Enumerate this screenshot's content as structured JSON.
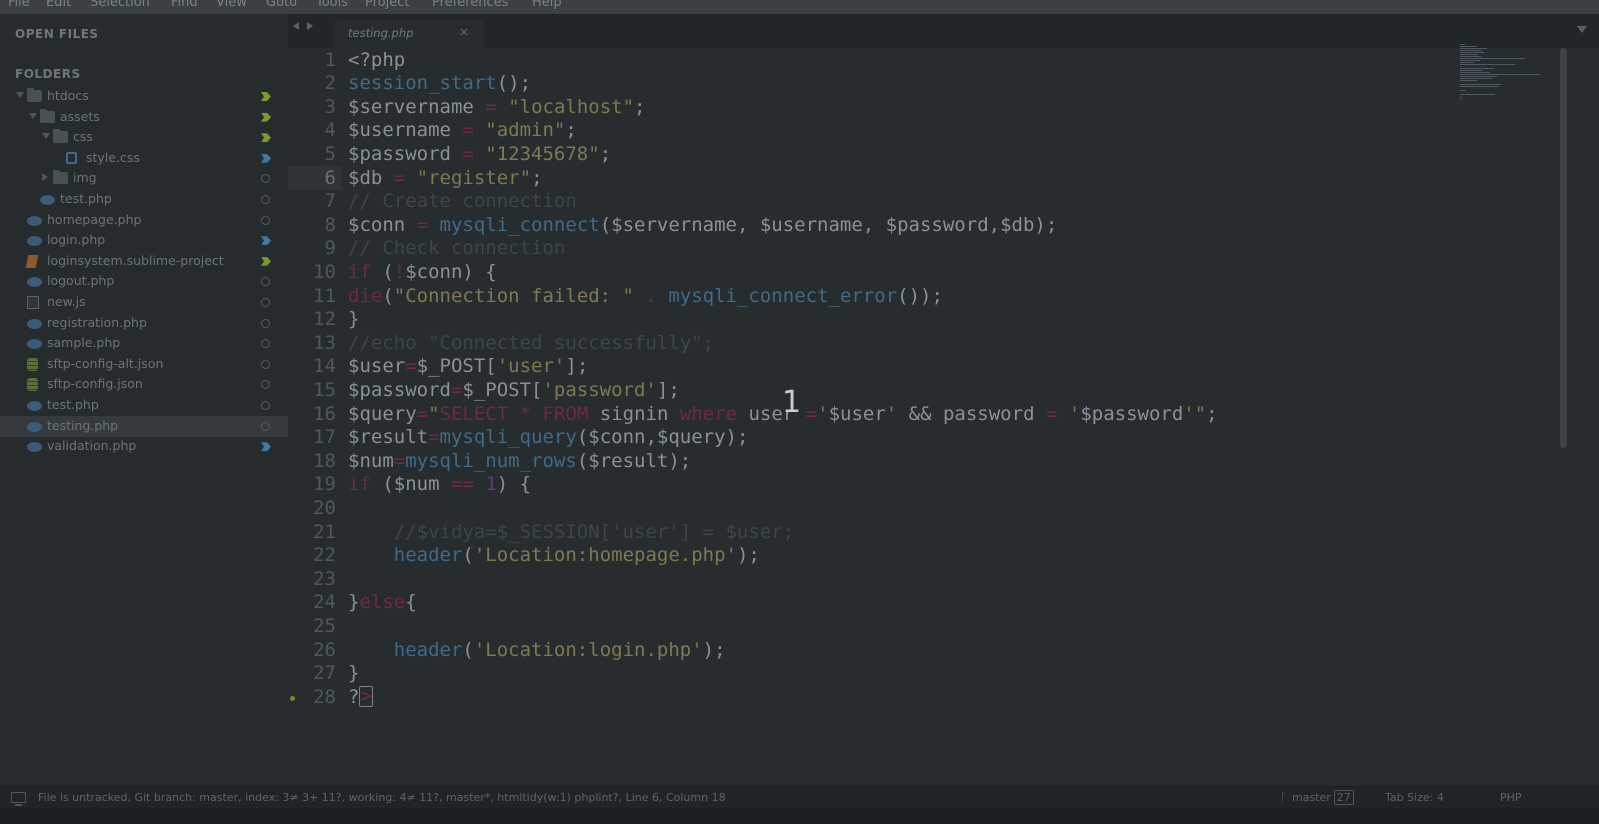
{
  "menu": [
    "File",
    "Edit",
    "Selection",
    "Find",
    "View",
    "Goto",
    "Tools",
    "Project",
    "Preferences",
    "Help"
  ],
  "sidebar": {
    "open_files_title": "OPEN FILES",
    "folders_title": "FOLDERS",
    "items": [
      {
        "label": "htdocs",
        "type": "folder",
        "expanded": true,
        "status": "modified"
      },
      {
        "label": "assets",
        "type": "folder",
        "expanded": true,
        "status": "modified"
      },
      {
        "label": "css",
        "type": "folder",
        "expanded": true,
        "status": "modified"
      },
      {
        "label": "style.css",
        "type": "css",
        "status": "modified-blue"
      },
      {
        "label": "img",
        "type": "folder",
        "expanded": false,
        "status": "untracked"
      },
      {
        "label": "test.php",
        "type": "php",
        "status": "untracked"
      },
      {
        "label": "homepage.php",
        "type": "php",
        "status": "untracked"
      },
      {
        "label": "login.php",
        "type": "php",
        "status": "modified-blue"
      },
      {
        "label": "loginsystem.sublime-project",
        "type": "sublime",
        "status": "modified"
      },
      {
        "label": "logout.php",
        "type": "php",
        "status": "untracked"
      },
      {
        "label": "new.js",
        "type": "js",
        "status": "untracked"
      },
      {
        "label": "registration.php",
        "type": "php",
        "status": "untracked"
      },
      {
        "label": "sample.php",
        "type": "php",
        "status": "untracked"
      },
      {
        "label": "sftp-config-alt.json",
        "type": "json",
        "status": "untracked"
      },
      {
        "label": "sftp-config.json",
        "type": "json",
        "status": "untracked"
      },
      {
        "label": "test.php",
        "type": "php",
        "status": "untracked"
      },
      {
        "label": "testing.php",
        "type": "php",
        "status": "untracked",
        "active": true
      },
      {
        "label": "validation.php",
        "type": "php",
        "status": "modified-blue"
      }
    ]
  },
  "tabs": {
    "active_label": "testing.php",
    "close_glyph": "×"
  },
  "editor": {
    "current_line": 6,
    "lines": [
      [
        [
          "t-pl",
          "<?php"
        ]
      ],
      [
        [
          "t-fn",
          "session_start"
        ],
        [
          "t-pl",
          "();"
        ]
      ],
      [
        [
          "t-pl",
          "$servername "
        ],
        [
          "t-op",
          "="
        ],
        [
          "t-pl",
          " "
        ],
        [
          "t-str",
          "\"localhost\""
        ],
        [
          "t-pl",
          ";"
        ]
      ],
      [
        [
          "t-pl",
          "$username "
        ],
        [
          "t-op",
          "="
        ],
        [
          "t-pl",
          " "
        ],
        [
          "t-str",
          "\"admin\""
        ],
        [
          "t-pl",
          ";"
        ]
      ],
      [
        [
          "t-pl",
          "$password "
        ],
        [
          "t-op",
          "="
        ],
        [
          "t-pl",
          " "
        ],
        [
          "t-str",
          "\"12345678\""
        ],
        [
          "t-pl",
          ";"
        ]
      ],
      [
        [
          "t-pl",
          "$db "
        ],
        [
          "t-op",
          "="
        ],
        [
          "t-pl",
          " "
        ],
        [
          "t-str",
          "\"register\""
        ],
        [
          "t-pl",
          ";"
        ]
      ],
      [
        [
          "t-cm",
          "// Create connection"
        ]
      ],
      [
        [
          "t-pl",
          "$conn "
        ],
        [
          "t-op",
          "="
        ],
        [
          "t-pl",
          " "
        ],
        [
          "t-fn",
          "mysqli_connect"
        ],
        [
          "t-pl",
          "($servername, $username, $password,$db);"
        ]
      ],
      [
        [
          "t-cm",
          "// Check connection"
        ]
      ],
      [
        [
          "t-kw",
          "if"
        ],
        [
          "t-pl",
          " ("
        ],
        [
          "t-op",
          "!"
        ],
        [
          "t-pl",
          "$conn) {"
        ]
      ],
      [
        [
          "t-kw",
          "die"
        ],
        [
          "t-pl",
          "("
        ],
        [
          "t-str",
          "\"Connection failed: \""
        ],
        [
          "t-pl",
          " "
        ],
        [
          "t-op",
          "."
        ],
        [
          "t-pl",
          " "
        ],
        [
          "t-fn",
          "mysqli_connect_error"
        ],
        [
          "t-pl",
          "());"
        ]
      ],
      [
        [
          "t-pl",
          "}"
        ]
      ],
      [
        [
          "t-cm",
          "//echo \"Connected successfully\";"
        ]
      ],
      [
        [
          "t-pl",
          "$user"
        ],
        [
          "t-op",
          "="
        ],
        [
          "t-pl",
          "$_POST["
        ],
        [
          "t-str",
          "'user'"
        ],
        [
          "t-pl",
          "];"
        ]
      ],
      [
        [
          "t-pl",
          "$password"
        ],
        [
          "t-op",
          "="
        ],
        [
          "t-pl",
          "$_POST["
        ],
        [
          "t-str",
          "'password'"
        ],
        [
          "t-pl",
          "];"
        ]
      ],
      [
        [
          "t-pl",
          "$query"
        ],
        [
          "t-op",
          "="
        ],
        [
          "t-str",
          "\""
        ],
        [
          "t-kw",
          "SELECT"
        ],
        [
          "t-pl",
          " "
        ],
        [
          "t-op",
          "*"
        ],
        [
          "t-pl",
          " "
        ],
        [
          "t-kw",
          "FROM"
        ],
        [
          "t-pl",
          " signin "
        ],
        [
          "t-kw",
          "where"
        ],
        [
          "t-pl",
          " user "
        ],
        [
          "t-op",
          "="
        ],
        [
          "t-str",
          "'"
        ],
        [
          "t-pl",
          "$user"
        ],
        [
          "t-str",
          "'"
        ],
        [
          "t-pl",
          " && password "
        ],
        [
          "t-op",
          "="
        ],
        [
          "t-pl",
          " "
        ],
        [
          "t-str",
          "'"
        ],
        [
          "t-pl",
          "$password"
        ],
        [
          "t-str",
          "'\""
        ],
        [
          "t-pl",
          ";"
        ]
      ],
      [
        [
          "t-pl",
          "$result"
        ],
        [
          "t-op",
          "="
        ],
        [
          "t-fn",
          "mysqli_query"
        ],
        [
          "t-pl",
          "($conn,$query);"
        ]
      ],
      [
        [
          "t-pl",
          "$num"
        ],
        [
          "t-op",
          "="
        ],
        [
          "t-fn",
          "mysqli_num_rows"
        ],
        [
          "t-pl",
          "($result);"
        ]
      ],
      [
        [
          "t-kw",
          "if"
        ],
        [
          "t-pl",
          " ($num "
        ],
        [
          "t-op",
          "=="
        ],
        [
          "t-pl",
          " "
        ],
        [
          "t-num",
          "1"
        ],
        [
          "t-pl",
          ") {"
        ]
      ],
      [
        [
          "t-pl",
          ""
        ]
      ],
      [
        [
          "t-pl",
          "    "
        ],
        [
          "t-cm",
          "//$vidya=$_SESSION['user'] = $user;"
        ]
      ],
      [
        [
          "t-pl",
          "    "
        ],
        [
          "t-fn",
          "header"
        ],
        [
          "t-pl",
          "("
        ],
        [
          "t-str",
          "'Location:homepage.php'"
        ],
        [
          "t-pl",
          ");"
        ]
      ],
      [
        [
          "t-pl",
          ""
        ]
      ],
      [
        [
          "t-pl",
          "}"
        ],
        [
          "t-kw",
          "else"
        ],
        [
          "t-pl",
          "{"
        ]
      ],
      [
        [
          "t-pl",
          ""
        ]
      ],
      [
        [
          "t-pl",
          "    "
        ],
        [
          "t-fn",
          "header"
        ],
        [
          "t-pl",
          "("
        ],
        [
          "t-str",
          "'Location:login.php'"
        ],
        [
          "t-pl",
          ");"
        ]
      ],
      [
        [
          "t-pl",
          "}"
        ]
      ],
      [
        [
          "t-pl",
          "?"
        ],
        [
          "cursor",
          ">"
        ]
      ]
    ]
  },
  "overlay_number": "1",
  "statusbar": {
    "left_text": "File is untracked, Git branch: master, index: 3≠ 3+ 11?, working: 4≠ 11?, master*, htmltidy(w:1) phplint?, Line 6, Column 18",
    "branch_label": "master",
    "branch_changes": "27",
    "tab_size": "Tab Size: 4",
    "syntax": "PHP"
  },
  "colors": {
    "background": "#272c2f",
    "sidebar": "#262b2e",
    "keyword": "#6e2a43",
    "function": "#3f6b88",
    "string": "#7d7a52",
    "git_modified": "#7a9a2a",
    "git_modified_blue": "#3f78a0"
  }
}
